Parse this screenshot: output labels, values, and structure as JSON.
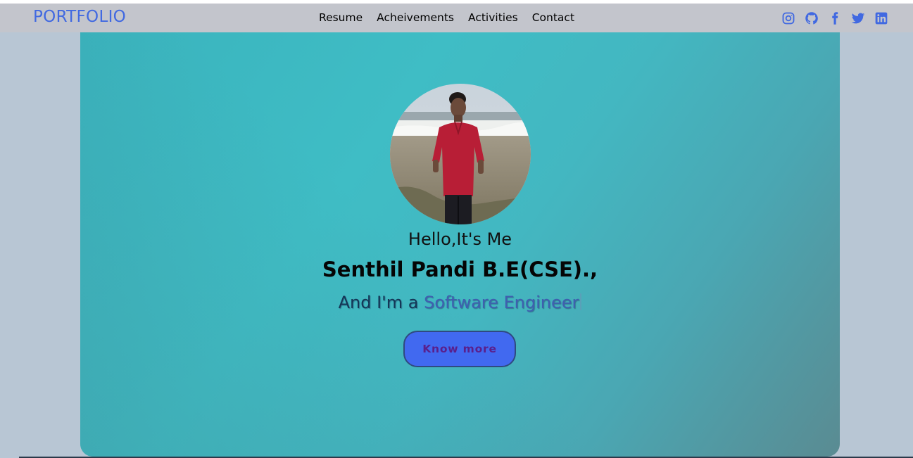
{
  "brand": {
    "logo": "PORTFOLIO",
    "accent_color": "#4169e1"
  },
  "nav": {
    "links": [
      {
        "label": "Resume"
      },
      {
        "label": "Acheivements"
      },
      {
        "label": "Activities"
      },
      {
        "label": "Contact"
      }
    ]
  },
  "socials": [
    {
      "icon": "instagram-icon"
    },
    {
      "icon": "github-icon"
    },
    {
      "icon": "facebook-icon"
    },
    {
      "icon": "twitter-icon"
    },
    {
      "icon": "linkedin-icon"
    }
  ],
  "hero": {
    "greeting": "Hello,It's Me",
    "name": "Senthil Pandi B.E(CSE).,",
    "role_prefix": "And I'm a ",
    "role": "Software Engineer",
    "cta_label": "Know more"
  }
}
